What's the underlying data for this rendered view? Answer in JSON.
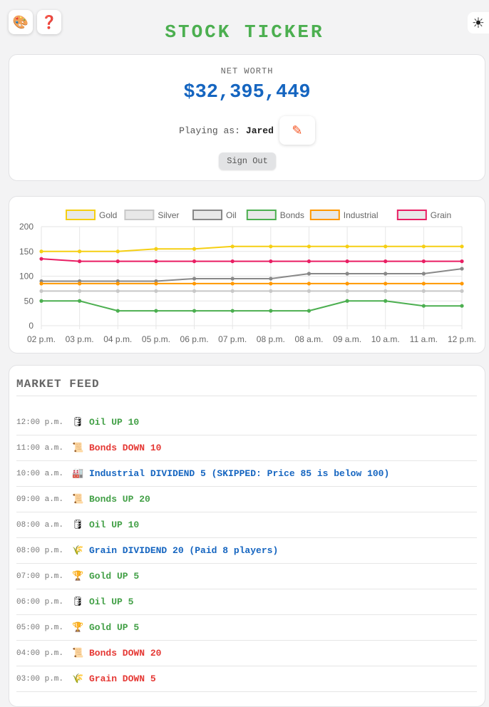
{
  "header": {
    "title": "STOCK TICKER",
    "palette_icon": "🎨",
    "help_icon": "❓",
    "theme_icon": "☀"
  },
  "account": {
    "net_worth_label": "NET WORTH",
    "net_worth_value": "$32,395,449",
    "playing_as_label": "Playing as:",
    "player_name": "Jared",
    "edit_icon": "✎",
    "sign_out_label": "Sign Out"
  },
  "chart_data": {
    "type": "line",
    "x": [
      "02 p.m.",
      "03 p.m.",
      "04 p.m.",
      "05 p.m.",
      "06 p.m.",
      "07 p.m.",
      "08 p.m.",
      "08 a.m.",
      "09 a.m.",
      "10 a.m.",
      "11 a.m.",
      "12 p.m."
    ],
    "ylim": [
      0,
      200
    ],
    "yticks": [
      0,
      50,
      100,
      150,
      200
    ],
    "grid": true,
    "legend": "top",
    "series": [
      {
        "name": "Gold",
        "color": "#f5cf13",
        "values": [
          150,
          150,
          150,
          155,
          155,
          160,
          160,
          160,
          160,
          160,
          160,
          160
        ]
      },
      {
        "name": "Silver",
        "color": "#c8c8c8",
        "values": [
          70,
          70,
          70,
          70,
          70,
          70,
          70,
          70,
          70,
          70,
          70,
          70
        ]
      },
      {
        "name": "Oil",
        "color": "#888888",
        "values": [
          90,
          90,
          90,
          90,
          95,
          95,
          95,
          105,
          105,
          105,
          105,
          115
        ]
      },
      {
        "name": "Bonds",
        "color": "#4caf50",
        "values": [
          50,
          50,
          30,
          30,
          30,
          30,
          30,
          30,
          50,
          50,
          40,
          40
        ]
      },
      {
        "name": "Industrial",
        "color": "#ff9800",
        "values": [
          85,
          85,
          85,
          85,
          85,
          85,
          85,
          85,
          85,
          85,
          85,
          85
        ]
      },
      {
        "name": "Grain",
        "color": "#e91e63",
        "values": [
          135,
          130,
          130,
          130,
          130,
          130,
          130,
          130,
          130,
          130,
          130,
          130
        ]
      }
    ]
  },
  "feed": {
    "title": "MARKET FEED",
    "colors": {
      "up": "#43a047",
      "down": "#e53935",
      "dividend": "#1565c0"
    },
    "items": [
      {
        "time": "12:00 p.m.",
        "icon": "🛢",
        "message": "Oil UP 10",
        "kind": "up"
      },
      {
        "time": "11:00 a.m.",
        "icon": "📜",
        "message": "Bonds DOWN 10",
        "kind": "down"
      },
      {
        "time": "10:00 a.m.",
        "icon": "🏭",
        "message": "Industrial DIVIDEND 5 (SKIPPED: Price 85 is below 100)",
        "kind": "dividend"
      },
      {
        "time": "09:00 a.m.",
        "icon": "📜",
        "message": "Bonds UP 20",
        "kind": "up"
      },
      {
        "time": "08:00 a.m.",
        "icon": "🛢",
        "message": "Oil UP 10",
        "kind": "up"
      },
      {
        "time": "08:00 p.m.",
        "icon": "🌾",
        "message": "Grain DIVIDEND 20 (Paid 8 players)",
        "kind": "dividend"
      },
      {
        "time": "07:00 p.m.",
        "icon": "🏆",
        "message": "Gold UP 5",
        "kind": "up"
      },
      {
        "time": "06:00 p.m.",
        "icon": "🛢",
        "message": "Oil UP 5",
        "kind": "up"
      },
      {
        "time": "05:00 p.m.",
        "icon": "🏆",
        "message": "Gold UP 5",
        "kind": "up"
      },
      {
        "time": "04:00 p.m.",
        "icon": "📜",
        "message": "Bonds DOWN 20",
        "kind": "down"
      },
      {
        "time": "03:00 p.m.",
        "icon": "🌾",
        "message": "Grain DOWN 5",
        "kind": "down"
      }
    ]
  }
}
